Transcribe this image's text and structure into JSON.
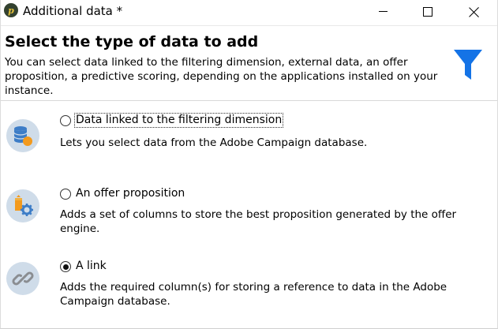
{
  "window": {
    "title": "Additional data *",
    "app_icon_glyph": "p"
  },
  "header": {
    "title": "Select the type of data to add",
    "description": "You can select data linked to the filtering dimension, external data, an offer proposition, a predictive scoring, depending on the applications installed on your instance.",
    "icon": "filter-funnel-icon",
    "icon_color": "#1473e6"
  },
  "options": [
    {
      "label": "Data linked to the filtering dimension",
      "description": "Lets you select data from the Adobe Campaign database.",
      "icon": "database-icon",
      "selected": false
    },
    {
      "label": "An offer proposition",
      "description": "Adds a set of columns to store the best proposition generated by the offer engine.",
      "icon": "offer-settings-icon",
      "selected": false
    },
    {
      "label": "A link",
      "description": "Adds the required column(s) for storing a reference to data in the Adobe Campaign database.",
      "icon": "chain-link-icon",
      "selected": true
    }
  ],
  "colors": {
    "icon_circle": "#cfdce9",
    "icon_blue": "#3d7dc7",
    "icon_orange": "#f39a1d"
  }
}
